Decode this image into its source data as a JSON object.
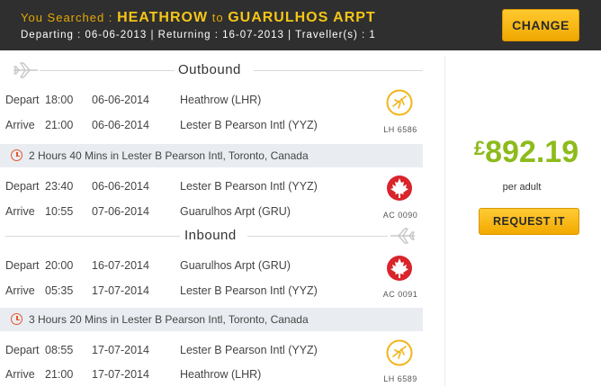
{
  "search": {
    "prefix": "You Searched :",
    "origin": "HEATHROW",
    "to_word": "to",
    "destination": "GUARULHOS ARPT",
    "details": "Departing : 06-06-2013 | Returning : 16-07-2013 | Traveller(s) : 1",
    "change_label": "CHANGE"
  },
  "colors": {
    "header_bg": "#2f2f2f",
    "accent": "#f5c518",
    "price": "#8dbb1c",
    "layover_bg": "#e9edf1",
    "clock": "#e8552c"
  },
  "outbound": {
    "title": "Outbound",
    "seg1": {
      "depart": {
        "label": "Depart",
        "time": "18:00",
        "date": "06-06-2014",
        "airport": "Heathrow (LHR)"
      },
      "arrive": {
        "label": "Arrive",
        "time": "21:00",
        "date": "06-06-2014",
        "airport": "Lester B Pearson Intl (YYZ)"
      },
      "airline_icon": "lufthansa-crane-logo",
      "flight": "LH 6586"
    },
    "layover": "2 Hours 40 Mins in Lester B Pearson Intl, Toronto, Canada",
    "seg2": {
      "depart": {
        "label": "Depart",
        "time": "23:40",
        "date": "06-06-2014",
        "airport": "Lester B Pearson Intl (YYZ)"
      },
      "arrive": {
        "label": "Arrive",
        "time": "10:55",
        "date": "07-06-2014",
        "airport": "Guarulhos Arpt (GRU)"
      },
      "airline_icon": "air-canada-maple-logo",
      "flight": "AC 0090"
    }
  },
  "inbound": {
    "title": "Inbound",
    "seg1": {
      "depart": {
        "label": "Depart",
        "time": "20:00",
        "date": "16-07-2014",
        "airport": "Guarulhos Arpt (GRU)"
      },
      "arrive": {
        "label": "Arrive",
        "time": "05:35",
        "date": "17-07-2014",
        "airport": "Lester B Pearson Intl (YYZ)"
      },
      "airline_icon": "air-canada-maple-logo",
      "flight": "AC 0091"
    },
    "layover": "3 Hours 20 Mins in Lester B Pearson Intl, Toronto, Canada",
    "seg2": {
      "depart": {
        "label": "Depart",
        "time": "08:55",
        "date": "17-07-2014",
        "airport": "Lester B Pearson Intl (YYZ)"
      },
      "arrive": {
        "label": "Arrive",
        "time": "21:00",
        "date": "17-07-2014",
        "airport": "Heathrow (LHR)"
      },
      "airline_icon": "lufthansa-crane-logo",
      "flight": "LH 6589"
    }
  },
  "fare": {
    "currency": "£",
    "amount": "892.19",
    "per": "per adult",
    "request_label": "REQUEST IT"
  }
}
